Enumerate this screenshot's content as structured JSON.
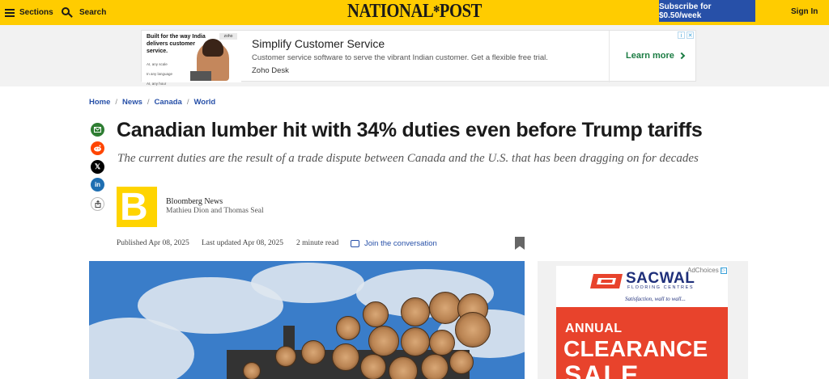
{
  "header": {
    "sections_label": "Sections",
    "search_label": "Search",
    "logo_text_1": "NATIONAL",
    "logo_text_2": "POST",
    "subscribe_label": "Subscribe for $0.50/week",
    "signin_label": "Sign In",
    "bar_color": "#ffcc00",
    "subscribe_color": "#2750a8"
  },
  "top_ad": {
    "image_text": "Built for the way India delivers customer service.",
    "image_bullets": [
      "AI, any scale",
      "In any language",
      "AI, any hour"
    ],
    "title": "Simplify Customer Service",
    "description": "Customer service software to serve the vibrant Indian customer. Get a flexible free trial.",
    "advertiser": "Zoho Desk",
    "cta": "Learn more"
  },
  "breadcrumb": [
    {
      "label": "Home"
    },
    {
      "label": "News"
    },
    {
      "label": "Canada"
    },
    {
      "label": "World"
    }
  ],
  "share": {
    "email_icon": "envelope-icon",
    "reddit_icon": "reddit-icon",
    "x_icon": "x-logo-icon",
    "linkedin_icon": "linkedin-icon",
    "linkedin_glyph": "in",
    "more_icon": "share-icon"
  },
  "article": {
    "headline": "Canadian lumber hit with 34% duties even before Trump tariffs",
    "deck": "The current duties are the result of a trade dispute between Canada and the U.S. that has been dragging on for decades",
    "source": "Bloomberg News",
    "authors": "Mathieu Dion and Thomas Seal",
    "published": "Published Apr 08, 2025",
    "updated": "Last updated Apr 08, 2025",
    "read_time": "2 minute read",
    "conversation_label": "Join the conversation"
  },
  "side_ad": {
    "adchoices_label": "AdChoices",
    "brand": "SACWAL",
    "brand_sub": "FLOORING CENTRES",
    "tagline": "Satisfaction, wall to wall...",
    "line1": "ANNUAL",
    "line2": "CLEARANCE",
    "line3": "SALE",
    "promo_color": "#e8432c"
  }
}
